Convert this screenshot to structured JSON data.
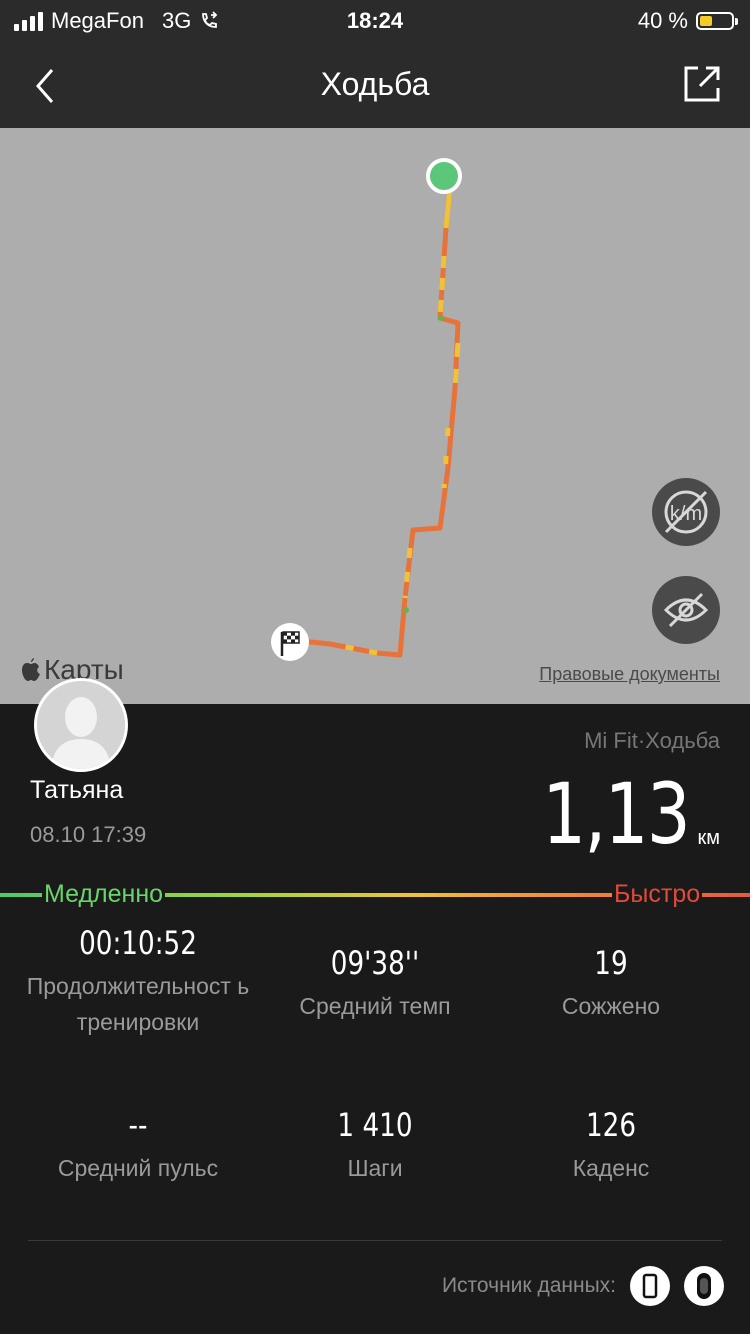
{
  "status_bar": {
    "carrier": "MegaFon",
    "network": "3G",
    "time": "18:24",
    "battery": "40 %",
    "battery_fill_color": "#f5cc27"
  },
  "nav": {
    "title": "Ходьба",
    "back_icon": "chevron-left-icon",
    "share_icon": "share-icon"
  },
  "map": {
    "provider_label": "Карты",
    "legal_link": "Правовые документы",
    "toggle_km_icon": "km-markers-off-icon",
    "toggle_visibility_icon": "eye-off-icon",
    "start_marker_color": "#5cc77a"
  },
  "workout": {
    "user_name": "Татьяна",
    "datetime": "08.10 17:39",
    "source_app": "Mi Fit·Ходьба",
    "distance": "1,13",
    "distance_unit": "км",
    "pace_slow_label": "Медленно",
    "pace_fast_label": "Быстро"
  },
  "stats": [
    {
      "value": "00:10:52",
      "label": "Продолжительност ь тренировки"
    },
    {
      "value": "09'38''",
      "label": "Средний темп"
    },
    {
      "value": "19",
      "label": "Сожжено"
    },
    {
      "value": "--",
      "label": "Средний пульс"
    },
    {
      "value": "1 410",
      "label": "Шаги"
    },
    {
      "value": "126",
      "label": "Каденс"
    }
  ],
  "data_source": {
    "label": "Источник данных:",
    "icons": [
      "phone-icon",
      "mi-band-icon"
    ]
  },
  "colors": {
    "route_primary": "#e8733a",
    "route_secondary": "#f0c23a",
    "pace_slow": "#6ad56a",
    "pace_fast": "#e14a3a"
  }
}
